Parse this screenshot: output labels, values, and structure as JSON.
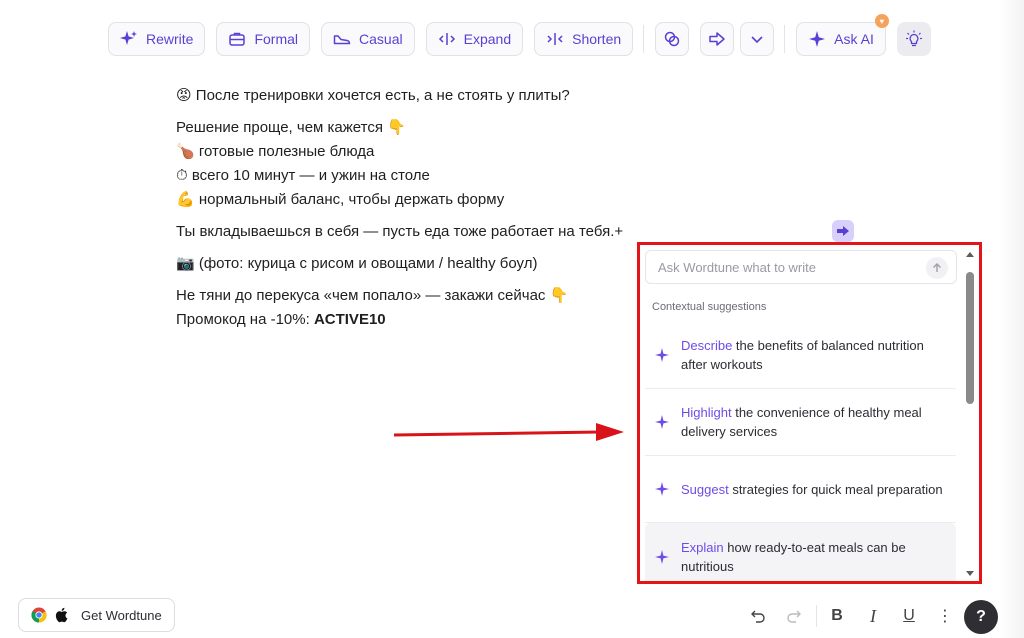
{
  "toolbar": {
    "rewrite": "Rewrite",
    "formal": "Formal",
    "casual": "Casual",
    "expand": "Expand",
    "shorten": "Shorten",
    "ask_ai": "Ask AI",
    "accent": "#5b3fd4"
  },
  "document": {
    "line1": "😡 После тренировки хочется есть, а не стоять у плиты?",
    "line2": "Решение проще, чем кажется 👇",
    "line3": "🍗 готовые полезные блюда",
    "line4": "⏱ всего 10 минут — и ужин на столе",
    "line5": "💪 нормальный баланс, чтобы держать форму",
    "line6": "Ты вкладываешься в себя — пусть еда тоже работает на тебя.+",
    "line7": "📷 (фото: курица с рисом и овощами / healthy боул)",
    "line8": "Не тяни до перекуса «чем попало» — закажи сейчас 👇",
    "line9_prefix": "Промокод на -10%: ",
    "promo_code": "ACTIVE10"
  },
  "panel": {
    "placeholder": "Ask Wordtune what to write",
    "section_label": "Contextual suggestions",
    "suggestions": [
      {
        "verb": "Describe",
        "rest": " the benefits of balanced nutrition after workouts"
      },
      {
        "verb": "Highlight",
        "rest": " the convenience of healthy meal delivery services"
      },
      {
        "verb": "Suggest",
        "rest": " strategies for quick meal preparation"
      },
      {
        "verb": "Explain",
        "rest": " how ready-to-eat meals can be nutritious"
      }
    ],
    "highlight_color": "#e4141b"
  },
  "footer": {
    "get_wordtune": "Get Wordtune",
    "bold": "B",
    "italic": "I",
    "underline": "U",
    "more": "⋮",
    "help": "?"
  }
}
